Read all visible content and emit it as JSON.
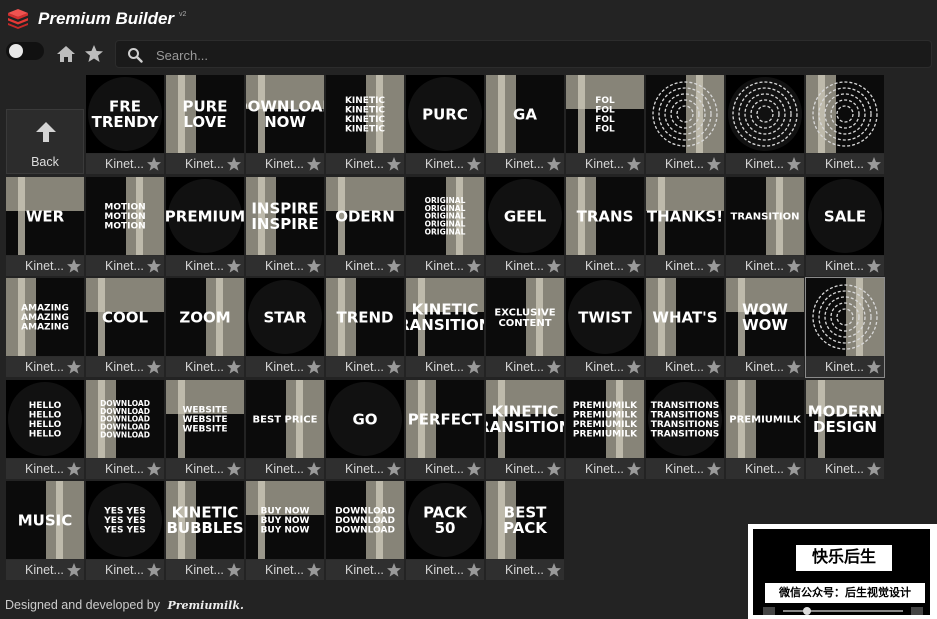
{
  "app": {
    "title": "Premium Builder",
    "version": "v2"
  },
  "toolbar": {
    "search_placeholder": "Search..."
  },
  "back_tile": {
    "label": "Back"
  },
  "tile_label": "Kinet...",
  "thumbnails": [
    [
      "FRE\nTRENDY",
      "PURE\nLOVE",
      "DOWNLOAD\nNOW",
      "KINETIC\nKINETIC\nKINETIC\nKINETIC",
      "PURC",
      "GA",
      "FOL\nFOL\nFOL\nFOL",
      "",
      "",
      ""
    ],
    [
      "WER",
      "MOTION\nMOTION\nMOTION",
      "PREMIUM",
      "INSPIRE\nINSPIRE",
      "ODERN",
      "ORIGINAL\nORIGINAL\nORIGINAL\nORIGINAL\nORIGINAL",
      "GEEL",
      "TRANS",
      "THANKS!",
      "TRANSITION",
      "SALE"
    ],
    [
      "AMAZING\nAMAZING\nAMAZING",
      "COOL",
      "ZOOM",
      "STAR",
      "TREND",
      "KINETIC\nTRANSITIONS",
      "EXCLUSIVE\nCONTENT",
      "TWIST",
      "WHAT'S",
      "WOW\nWOW",
      ""
    ],
    [
      "HELLO\nHELLO\nHELLO\nHELLO",
      "DOWNLOAD\nDOWNLOAD\nDOWNLOAD\nDOWNLOAD\nDOWNLOAD",
      "WEBSITE\nWEBSITE\nWEBSITE",
      "BEST PRICE",
      "GO",
      "PERFECT",
      "KINETIC\nTRANSITIONS",
      "PREMIUMILK\nPREMIUMILK\nPREMIUMILK\nPREMIUMILK",
      "TRANSITIONS\nTRANSITIONS\nTRANSITIONS\nTRANSITIONS",
      "PREMIUMILK",
      "MODERN\nDESIGN"
    ],
    [
      "MUSIC",
      "YES YES\nYES YES\nYES YES",
      "KINETIC\nBUBBLES",
      "BUY NOW\nBUY NOW\nBUY NOW",
      "DOWNLOAD\nDOWNLOAD\nDOWNLOAD",
      "PACK\n50",
      "BEST\nPACK"
    ]
  ],
  "footer": {
    "text": "Designed and developed by",
    "brand": "Premiumilk."
  },
  "watermark": {
    "top": "快乐后生",
    "bottom": "微信公众号：后生视觉设计"
  },
  "colors": {
    "background": "#232323",
    "logo": "#e53935"
  }
}
